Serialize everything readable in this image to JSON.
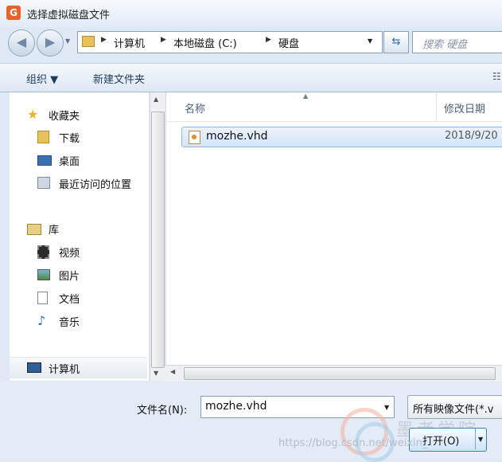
{
  "window": {
    "icon_letter": "G",
    "title": "选择虚拟磁盘文件"
  },
  "address": {
    "crumbs": [
      "计算机",
      "本地磁盘 (C:)",
      "硬盘"
    ],
    "search_placeholder": "搜索 硬盘"
  },
  "toolbar": {
    "organize_label": "组织 ▼",
    "new_folder_label": "新建文件夹"
  },
  "nav": {
    "favorites_label": "收藏夹",
    "favorites": [
      "下载",
      "桌面",
      "最近访问的位置"
    ],
    "libraries_label": "库",
    "libraries": [
      "视频",
      "图片",
      "文档",
      "音乐"
    ],
    "computer_label": "计算机"
  },
  "filelist": {
    "columns": [
      "名称",
      "修改日期"
    ],
    "files": [
      {
        "name": "mozhe.vhd",
        "date": "2018/9/20"
      }
    ]
  },
  "bottom": {
    "filename_label": "文件名(N):",
    "filename_value": "mozhe.vhd",
    "filetype_value": "所有映像文件(*.v",
    "open_label": "打开(O)"
  },
  "watermark": {
    "url": "https://blog.csdn.net/weixin_",
    "brand": "墨者学院"
  },
  "colors": {
    "selection": "#d3e6fb",
    "accent": "#3c7fb1"
  }
}
